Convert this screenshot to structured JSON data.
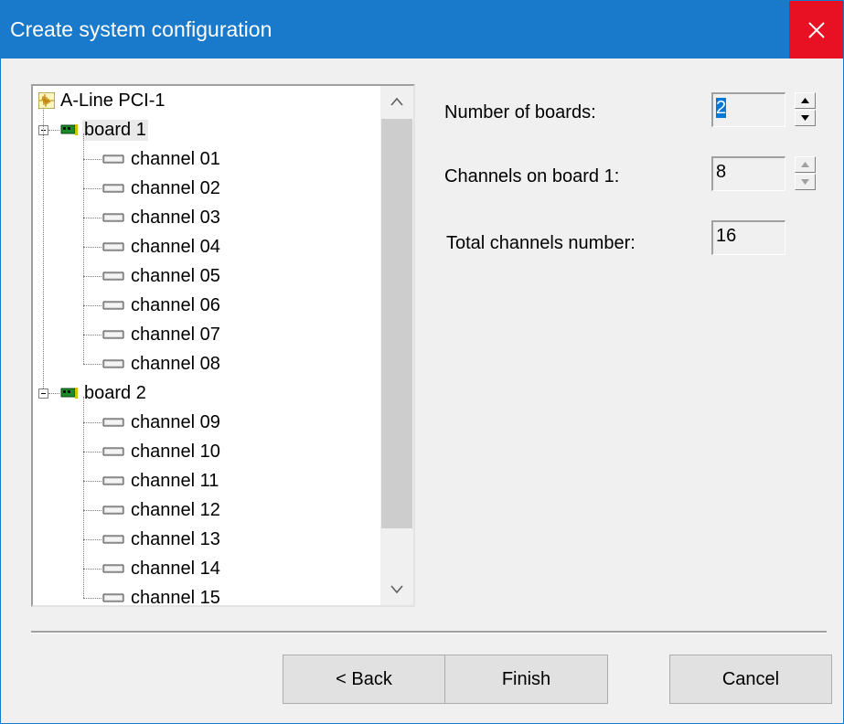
{
  "window": {
    "title": "Create system configuration"
  },
  "tree": {
    "root": {
      "label": "A-Line PCI-1",
      "icon": "waveform-icon"
    },
    "boards": [
      {
        "label": "board 1",
        "icon": "circuit-board-icon",
        "expanded": true,
        "channels": [
          "channel 01",
          "channel 02",
          "channel 03",
          "channel 04",
          "channel 05",
          "channel 06",
          "channel 07",
          "channel 08"
        ]
      },
      {
        "label": "board 2",
        "icon": "circuit-board-icon",
        "expanded": true,
        "channels": [
          "channel 09",
          "channel 10",
          "channel 11",
          "channel 12",
          "channel 13",
          "channel 14",
          "channel 15"
        ]
      }
    ],
    "selected": "board 1"
  },
  "form": {
    "boards_label": "Number of boards:",
    "boards_value": "2",
    "channels_label": "Channels on board 1:",
    "channels_value": "8",
    "total_label": "Total channels number:",
    "total_value": "16"
  },
  "buttons": {
    "back": "< Back",
    "finish": "Finish",
    "cancel": "Cancel"
  },
  "colors": {
    "titlebar": "#1979ca",
    "close": "#e81123",
    "selection": "#0078d7"
  }
}
